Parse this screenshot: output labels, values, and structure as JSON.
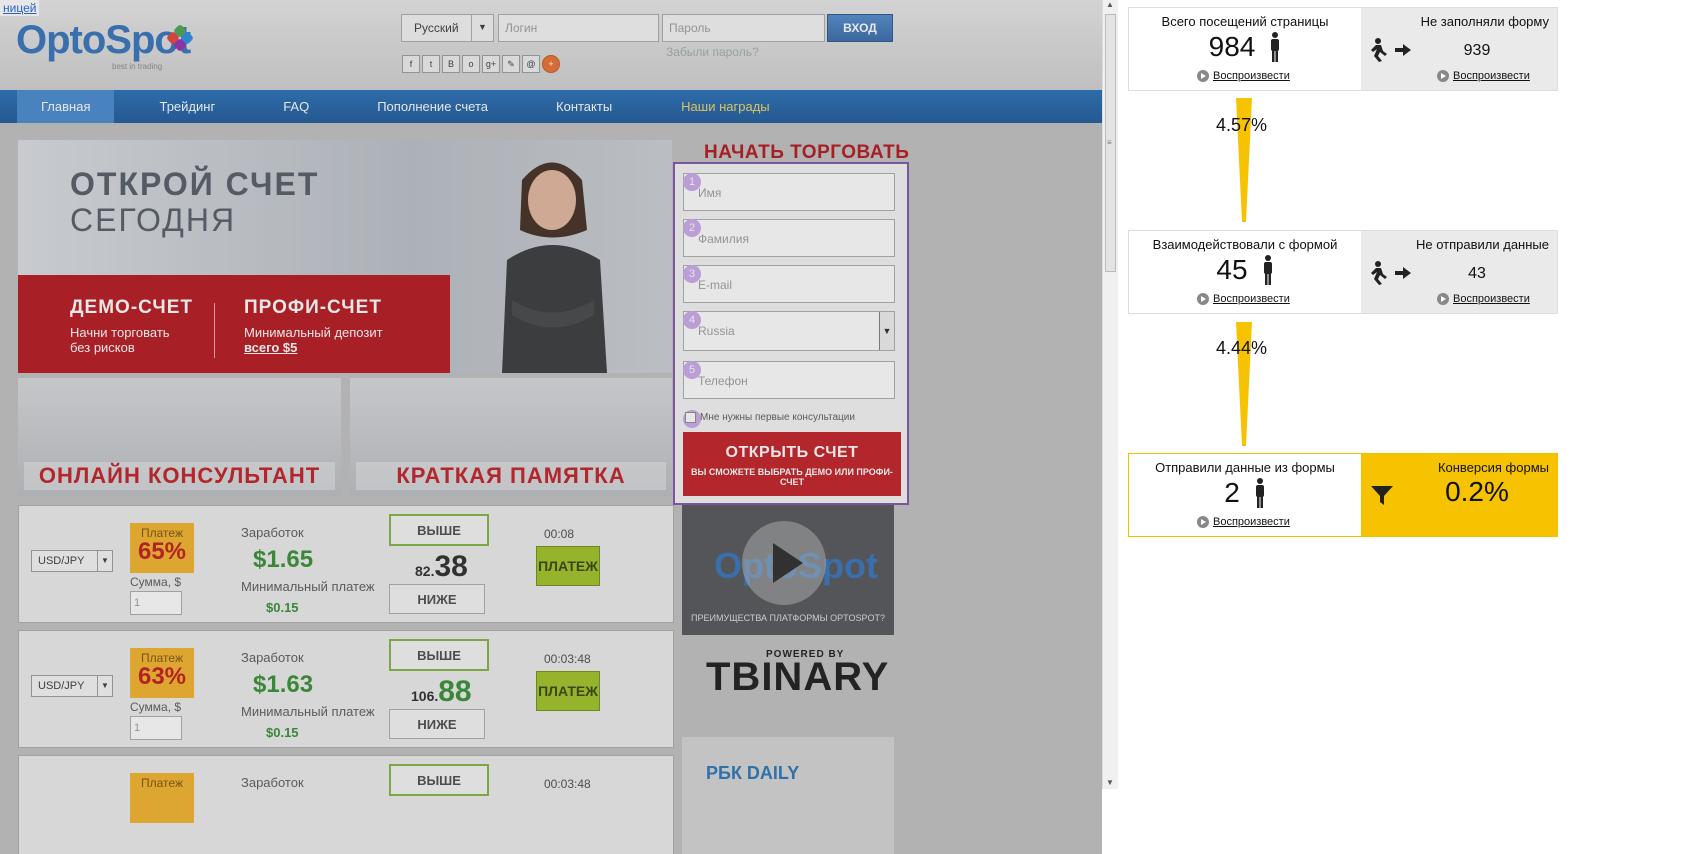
{
  "site": {
    "corner_tag": "ницей",
    "logo": "OptoSpot",
    "logo_tagline": "best in trading",
    "lang": "Русский",
    "login_placeholder": "Логин",
    "password_placeholder": "Пароль",
    "login_button": "ВХОД",
    "forgot": "Забыли пароль?",
    "socials": [
      "f",
      "t",
      "B",
      "o",
      "g+",
      "✎",
      "@",
      "+"
    ],
    "nav": [
      "Главная",
      "Трейдинг",
      "FAQ",
      "Пополнение счета",
      "Контакты",
      "Наши награды"
    ],
    "hero": {
      "line1": "ОТКРОЙ СЧЕТ",
      "line2": "СЕГОДНЯ",
      "demo_title": "ДЕМО-СЧЕТ",
      "demo_l1": "Начни торговать",
      "demo_l2": "без рисков",
      "pro_title": "ПРОФИ-СЧЕТ",
      "pro_l1": "Минимальный депозит",
      "pro_l2": "всего $5"
    },
    "promo": [
      "ОНЛАЙН КОНСУЛЬТАНТ",
      "КРАТКАЯ ПАМЯТКА"
    ],
    "trades": [
      {
        "pair": "USD/JPY",
        "pay_label": "Платеж",
        "pay": "65%",
        "sum_label": "Сумма, $",
        "sum": "1",
        "earn_label": "Заработок",
        "earn": "$1.65",
        "min_label": "Минимальный платеж",
        "min": "$0.15",
        "up": "ВЫШЕ",
        "price_small": "82.",
        "price_big": "38",
        "down": "НИЖЕ",
        "time": "00:08",
        "pay_btn": "ПЛАТЕЖ"
      },
      {
        "pair": "USD/JPY",
        "pay_label": "Платеж",
        "pay": "63%",
        "sum_label": "Сумма, $",
        "sum": "1",
        "earn_label": "Заработок",
        "earn": "$1.63",
        "min_label": "Минимальный платеж",
        "min": "$0.15",
        "up": "ВЫШЕ",
        "price_small": "106.",
        "price_big": "88",
        "down": "НИЖЕ",
        "time": "00:03:48",
        "pay_btn": "ПЛАТЕЖ"
      },
      {
        "pay_label": "Платеж",
        "earn_label": "Заработок",
        "up": "ВЫШЕ",
        "time": "00:03:48"
      }
    ],
    "form": {
      "title": "НАЧАТЬ ТОРГОВАТЬ",
      "fields": [
        "Имя",
        "Фамилия",
        "E-mail",
        "Russia",
        "Телефон"
      ],
      "nums": [
        "1",
        "2",
        "3",
        "4",
        "5",
        "6"
      ],
      "consult": "Мне нужны первые консультации",
      "submit": "ОТКРЫТЬ СЧЕТ",
      "submit_sub": "ВЫ СМОЖЕТЕ ВЫБРАТЬ ДЕМО ИЛИ ПРОФИ-СЧЕТ"
    },
    "video_caption": "ПРЕИМУЩЕСТВА ПЛАТФОРМЫ OPTOSPOT?",
    "tbinary_powered": "POWERED BY",
    "tbinary": "TBINARY",
    "rbk": "РБК DAILY"
  },
  "analytics": {
    "play_label": "Воспроизвести",
    "stages": [
      {
        "title": "Всего посещений страницы",
        "value": "984",
        "side_title": "Не заполняли форму",
        "side_value": "939"
      },
      {
        "title": "Взаимодействовали с формой",
        "value": "45",
        "side_title": "Не отправили данные",
        "side_value": "43"
      },
      {
        "title": "Отправили данные из формы",
        "value": "2",
        "side_title": "Конверсия формы",
        "side_value": "0.2%"
      }
    ],
    "step_pcts": [
      "4.57%",
      "4.44%"
    ],
    "accent": "#f7c300"
  }
}
